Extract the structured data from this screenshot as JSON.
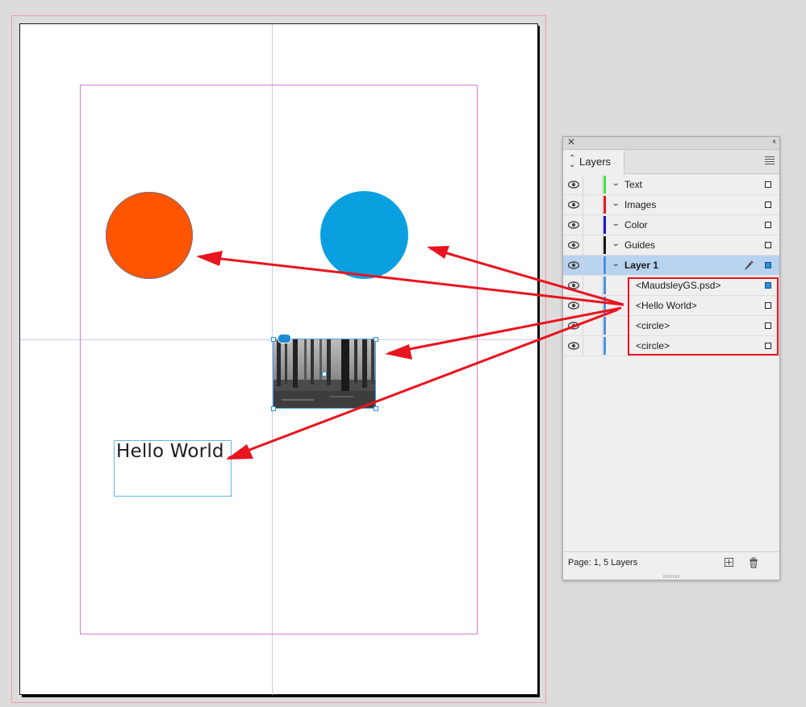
{
  "document": {
    "text_frame": {
      "text": "Hello World"
    }
  },
  "layers_panel": {
    "tab_label": "Layers",
    "layers": [
      {
        "label": "Text",
        "color": "#3ee63e",
        "expanded": false,
        "selected": false,
        "box": "empty"
      },
      {
        "label": "Images",
        "color": "#e81818",
        "expanded": false,
        "selected": false,
        "box": "empty"
      },
      {
        "label": "Color",
        "color": "#1414d6",
        "expanded": false,
        "selected": false,
        "box": "empty"
      },
      {
        "label": "Guides",
        "color": "#111111",
        "expanded": false,
        "selected": false,
        "box": "empty"
      },
      {
        "label": "Layer 1",
        "color": "#4a90e6",
        "expanded": true,
        "selected": true,
        "box": "filled"
      }
    ],
    "objects": [
      {
        "label": "<MaudsleyGS.psd>",
        "box": "filled"
      },
      {
        "label": "<Hello World>",
        "box": "empty"
      },
      {
        "label": "<circle>",
        "box": "empty"
      },
      {
        "label": "<circle>",
        "box": "empty"
      }
    ],
    "footer_text": "Page: 1, 5 Layers"
  },
  "colors": {
    "orange_circle": "#ff5400",
    "blue_circle": "#0aa0e0",
    "annotation": "#e8141e",
    "margin_guide": "#d77cd7",
    "bleed_guide": "#f09aa6",
    "selection": "#b8d3ef"
  },
  "icons": {
    "visibility": "eye-icon",
    "pen": "pen-icon",
    "new_layer": "new-layer-icon",
    "delete": "trash-icon",
    "panel_menu": "hamburger-menu-icon",
    "close": "close-icon",
    "collapse": "double-chevron-left-icon"
  }
}
